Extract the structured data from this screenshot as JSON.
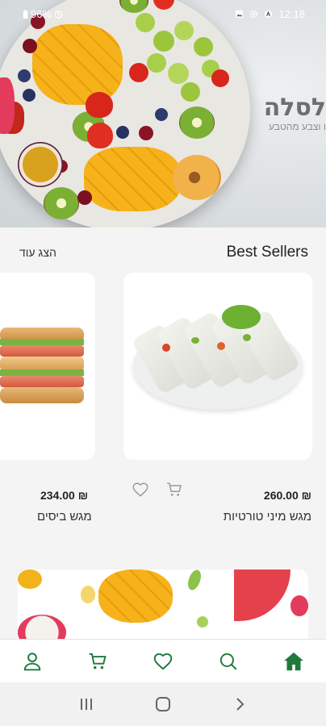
{
  "status_bar": {
    "battery": "96%",
    "time": "12:18",
    "icons": [
      "battery-icon",
      "alarm-icon",
      "gallery-icon",
      "settings-icon",
      "app-icon"
    ]
  },
  "hero": {
    "brand": "לסלה",
    "tagline": "ו וצבע מהטבע"
  },
  "best_sellers": {
    "title": "Best Sellers",
    "show_more": "הצג עוד",
    "products": [
      {
        "name": "מגש מיני טורטיות",
        "price": "260.00 ₪",
        "icons": [
          "heart-icon",
          "cart-icon"
        ]
      },
      {
        "name": "מגש ביסים",
        "price": "234.00 ₪"
      }
    ]
  },
  "bottom_nav": {
    "items": [
      "home-icon",
      "search-icon",
      "heart-icon",
      "cart-icon",
      "user-icon"
    ],
    "active": "home-icon",
    "accent": "#1e7a3c"
  },
  "system_nav": [
    "recent-apps-icon",
    "home-button-icon",
    "back-icon"
  ]
}
